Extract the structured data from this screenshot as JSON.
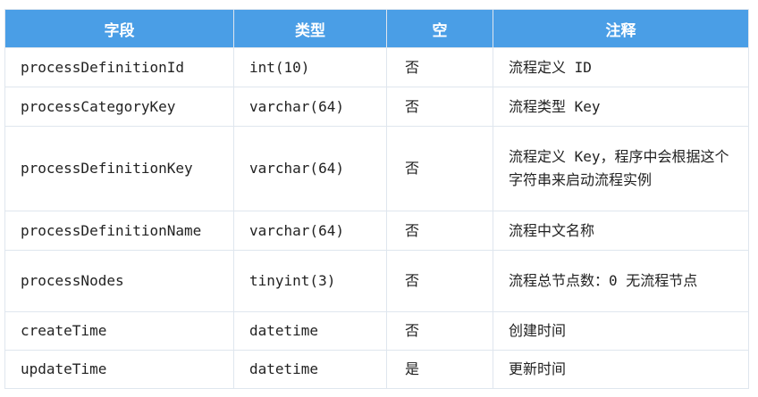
{
  "headers": [
    "字段",
    "类型",
    "空",
    "注释"
  ],
  "rows": [
    {
      "field": "processDefinitionId",
      "type": "int(10)",
      "nullable": "否",
      "comment": "流程定义 ID"
    },
    {
      "field": "processCategoryKey",
      "type": "varchar(64)",
      "nullable": "否",
      "comment": "流程类型 Key"
    },
    {
      "field": "processDefinitionKey",
      "type": "varchar(64)",
      "nullable": "否",
      "comment": "流程定义 Key，程序中会根据这个字符串来启动流程实例"
    },
    {
      "field": "processDefinitionName",
      "type": "varchar(64)",
      "nullable": "否",
      "comment": "流程中文名称"
    },
    {
      "field": "processNodes",
      "type": "tinyint(3)",
      "nullable": "否",
      "comment": "流程总节点数：0 无流程节点"
    },
    {
      "field": "createTime",
      "type": "datetime",
      "nullable": "否",
      "comment": "创建时间"
    },
    {
      "field": "updateTime",
      "type": "datetime",
      "nullable": "是",
      "comment": "更新时间"
    }
  ]
}
